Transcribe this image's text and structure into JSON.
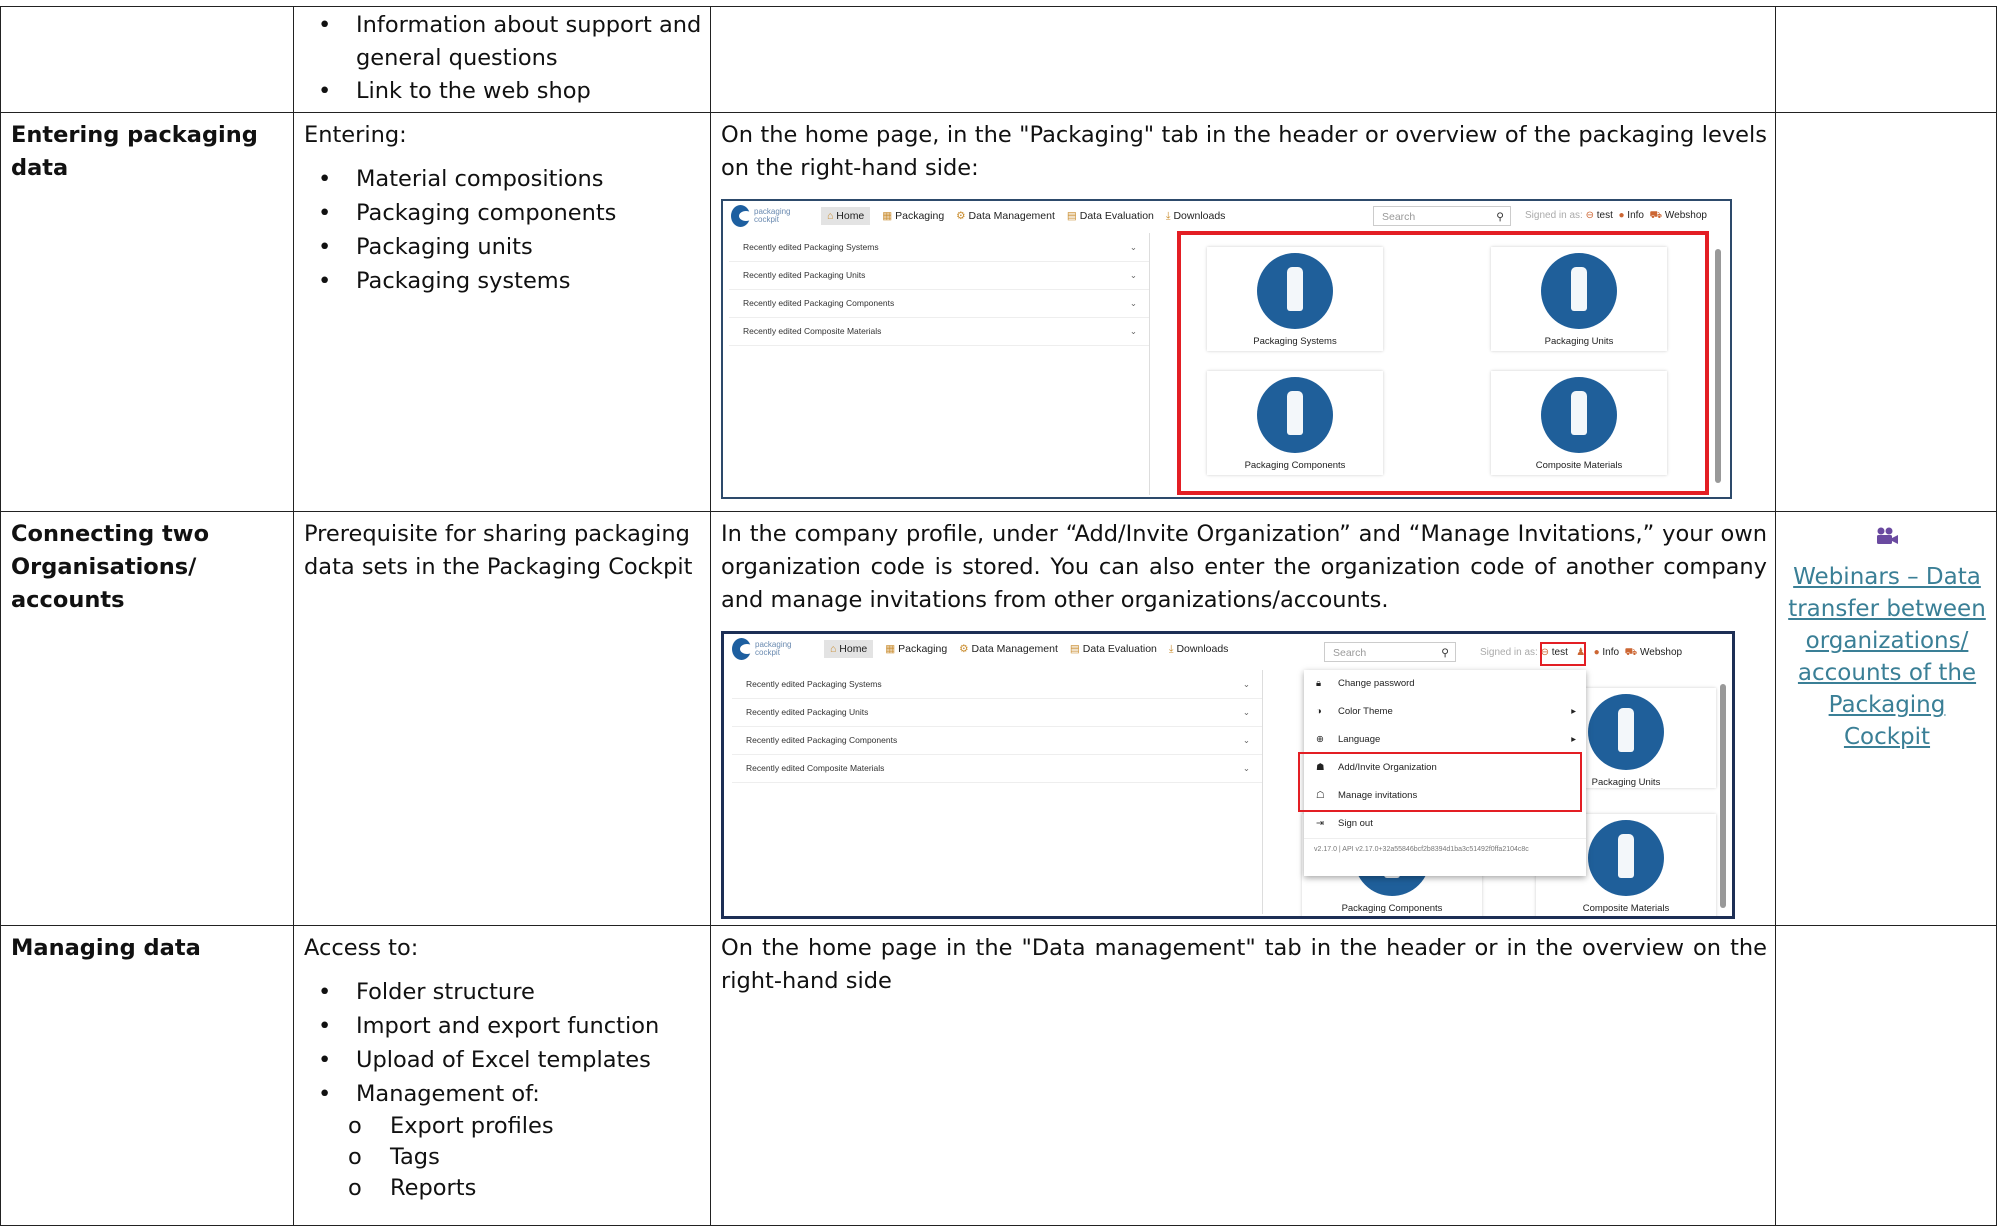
{
  "rows": [
    {
      "c1": "",
      "c2_bullets": [
        "Information about support and general questions",
        "Link to the web shop"
      ]
    },
    {
      "c1": "Entering packaging data",
      "c2_intro": "Entering:",
      "c2_bullets": [
        "Material compositions",
        "Packaging components",
        "Packaging units",
        "Packaging systems"
      ],
      "c3_text": "On the home page, in the \"Packaging\" tab in the header or overview of the packaging levels on the right-hand side:"
    },
    {
      "c1": "Connecting two Organisations/ accounts",
      "c2_text": "Prerequisite for sharing packaging data sets in the Packaging Cockpit",
      "c3_text": "In the company profile, under “Add/Invite Organization” and “Manage Invitations,” your own organization code is stored. You can also enter the organization code of another company and manage invitations from other organizations/accounts.",
      "c4_icon": "video-camera-icon",
      "c4_link": "Webinars – Data transfer between organizations/ accounts of the Packaging Cockpit"
    },
    {
      "c1": "Managing data",
      "c2_intro": "Access to:",
      "c2_bullets": [
        "Folder structure",
        "Import and export function",
        "Upload of Excel templates",
        "Management of:"
      ],
      "c2_sub": [
        "Export profiles",
        "Tags",
        "Reports"
      ],
      "c3_text": "On the home page in the \"Data management\" tab in the header or in the overview on the right-hand side"
    }
  ],
  "app": {
    "logo_text": "packaging cockpit",
    "nav": [
      "Home",
      "Packaging",
      "Data Management",
      "Data Evaluation",
      "Downloads"
    ],
    "search_placeholder": "Search",
    "signed_in": "Signed in as:",
    "user": "test",
    "info": "Info",
    "webshop": "Webshop",
    "recent": [
      "Recently edited Packaging Systems",
      "Recently edited Packaging Units",
      "Recently edited Packaging Components",
      "Recently edited Composite Materials"
    ],
    "tiles": [
      "Packaging Systems",
      "Packaging Units",
      "Packaging Components",
      "Composite Materials"
    ],
    "user_menu": [
      "Change password",
      "Color Theme",
      "Language",
      "Add/Invite Organization",
      "Manage invitations",
      "Sign out"
    ],
    "version": "v2.17.0 | API v2.17.0+32a55846bcf2b8394d1ba3c51492f0ffa2104c8c"
  },
  "colors": {
    "icon_blue": "#1f5f9a",
    "highlight_red": "#e31e24",
    "link": "#3a7f96"
  }
}
